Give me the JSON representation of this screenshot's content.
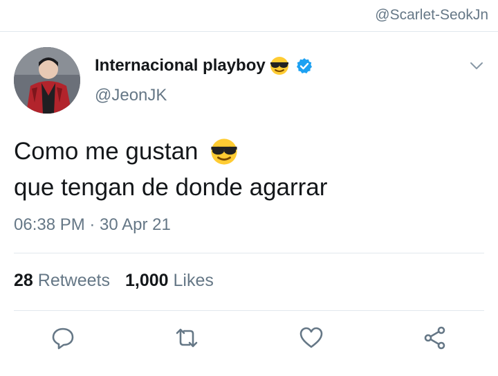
{
  "watermark": "@Scarlet-SeokJn",
  "user": {
    "display_name": "Internacional playboy",
    "handle": "@JeonJK"
  },
  "tweet": {
    "line1": "Como me gustan",
    "line2": "que tengan de donde agarrar",
    "timestamp": "06:38 PM · 30 Apr 21"
  },
  "stats": {
    "retweets_count": "28",
    "retweets_label": "Retweets",
    "likes_count": "1,000",
    "likes_label": "Likes"
  },
  "icons": {
    "emoji": "smiling-face-with-sunglasses",
    "verified": "verified-badge",
    "menu": "chevron-down",
    "reply": "speech-bubble",
    "retweet": "retweet-arrows",
    "like": "heart",
    "share": "share-nodes"
  },
  "colors": {
    "verified_blue": "#1da1f2",
    "secondary_text": "#657786",
    "primary_text": "#14171a",
    "divider": "#e1e8ed"
  }
}
